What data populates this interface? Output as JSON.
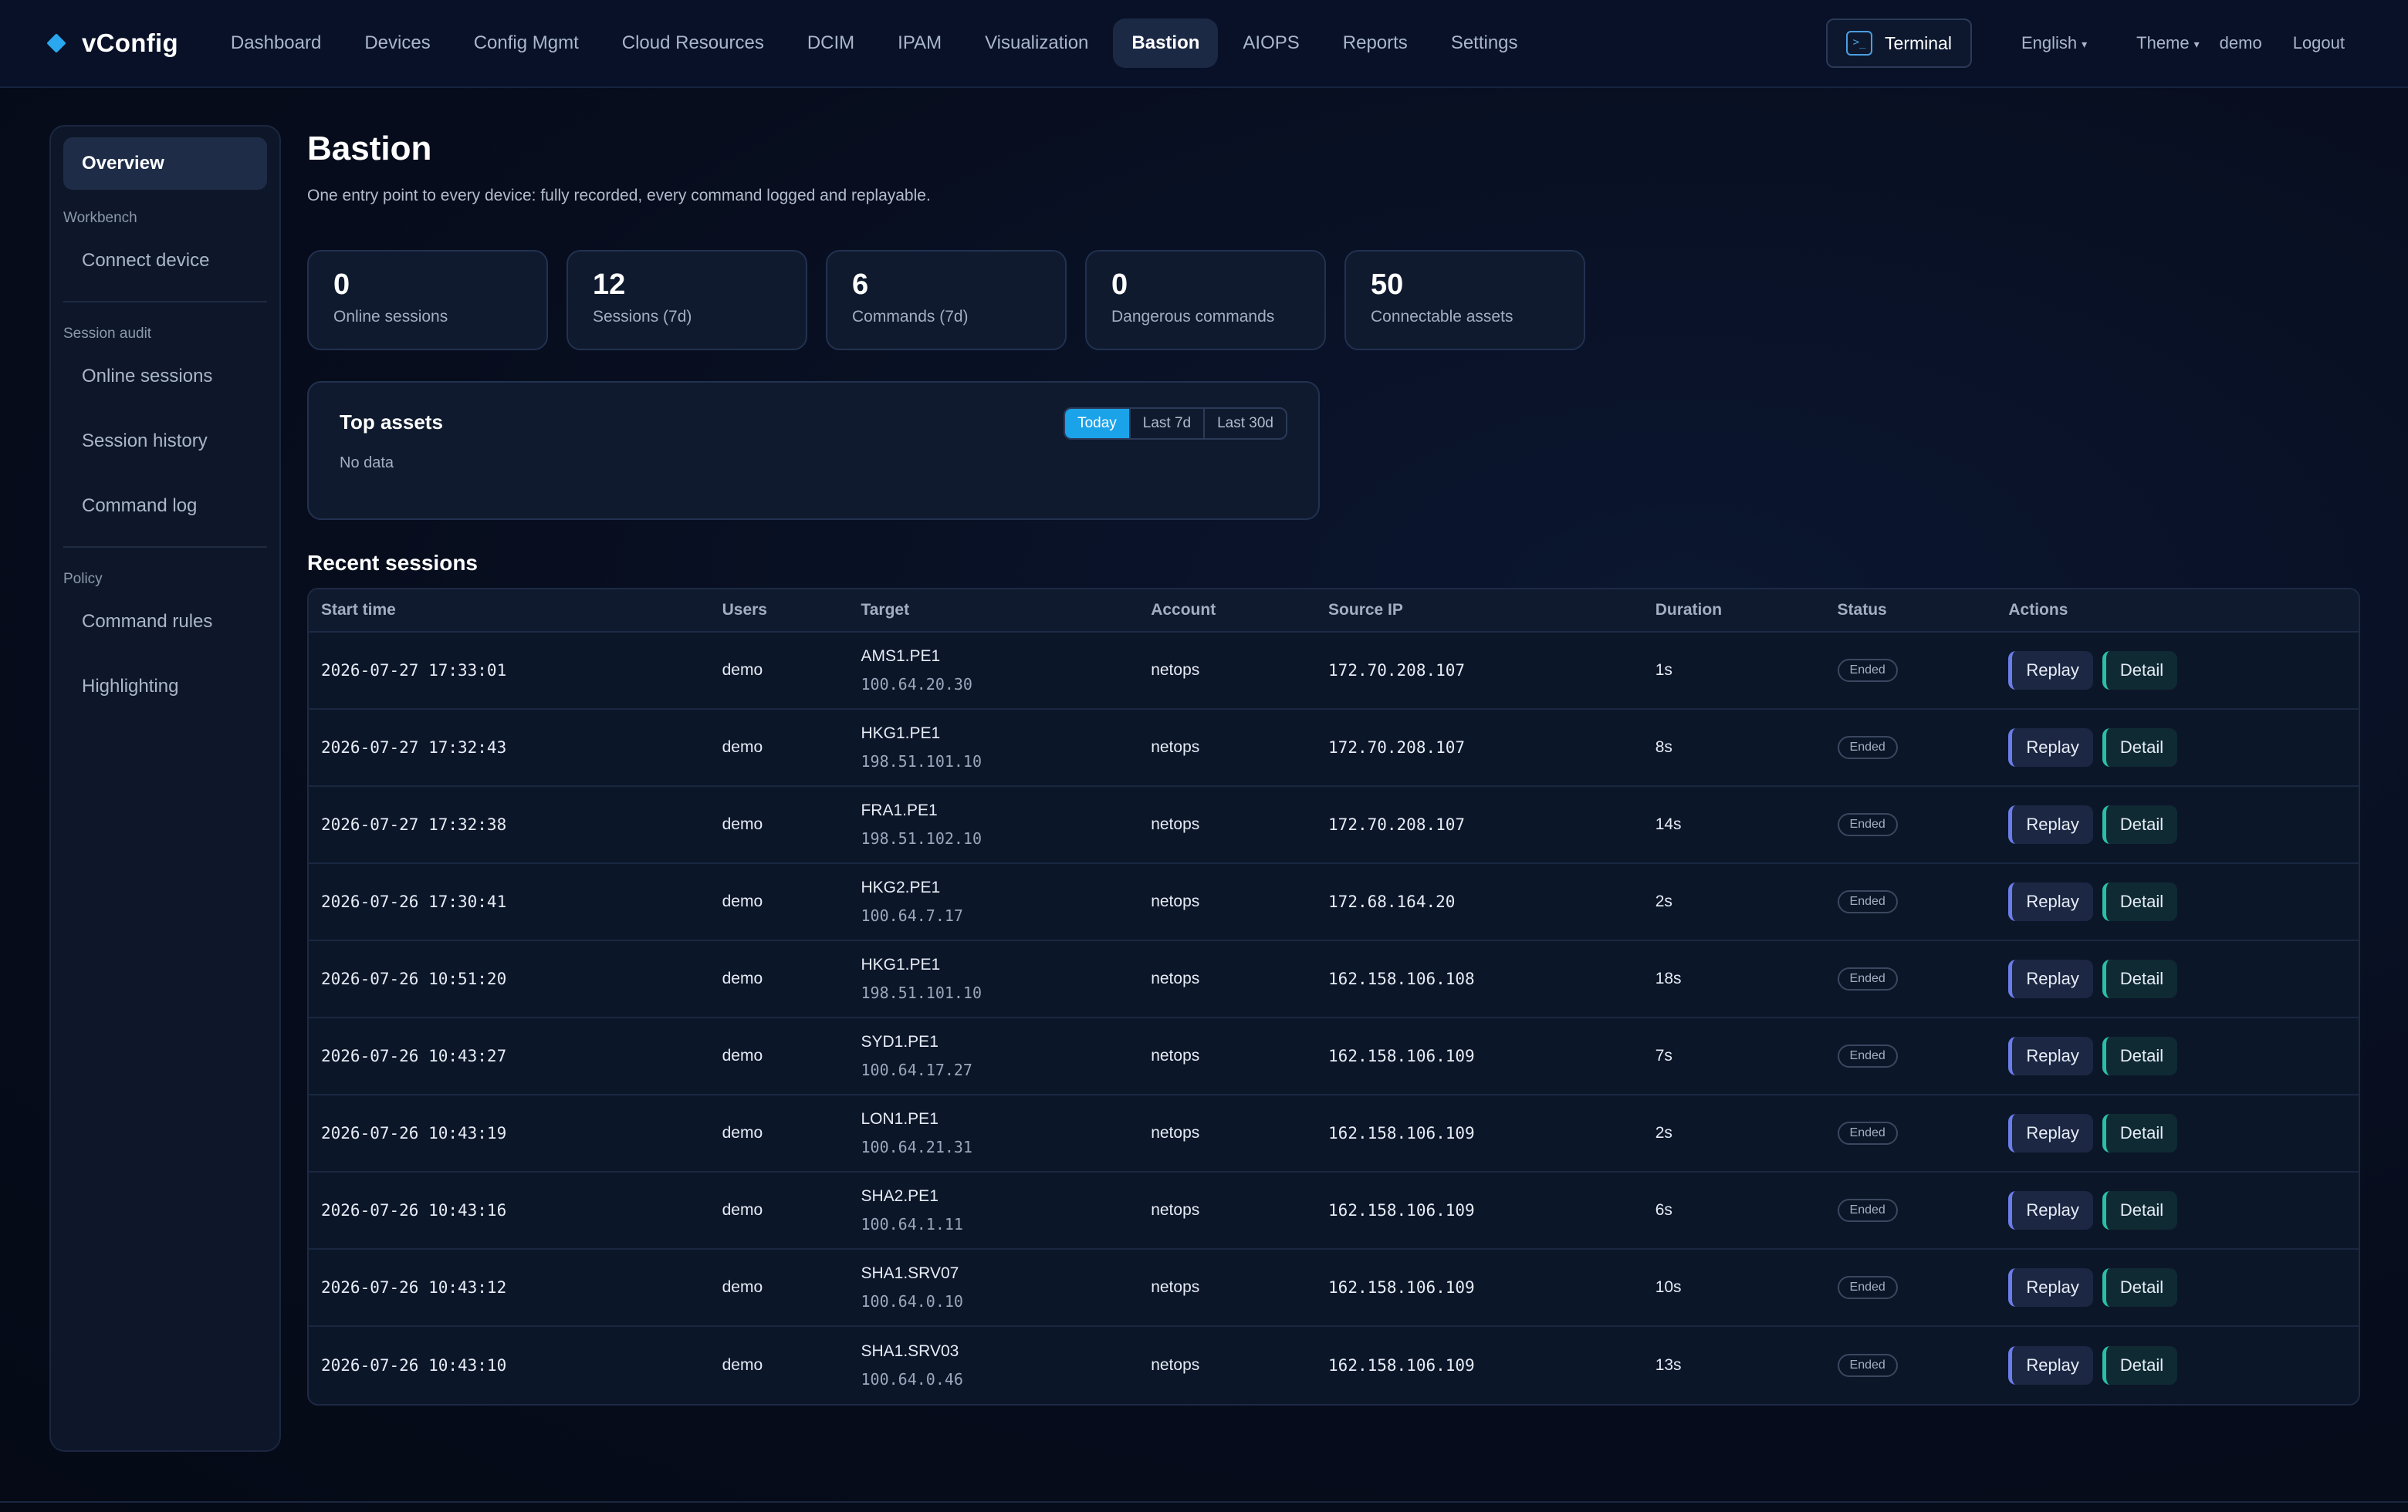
{
  "header": {
    "brand": "vConfig",
    "nav": [
      "Dashboard",
      "Devices",
      "Config Mgmt",
      "Cloud Resources",
      "DCIM",
      "IPAM",
      "Visualization",
      "Bastion",
      "AIOPS",
      "Reports",
      "Settings"
    ],
    "active_nav": "Bastion",
    "terminal_label": "Terminal",
    "terminal_icon": ">_",
    "language": "English",
    "theme": "Theme",
    "user": "demo",
    "logout": "Logout"
  },
  "sidebar": {
    "overview": "Overview",
    "section_workbench": "Workbench",
    "connect_device": "Connect device",
    "section_audit": "Session audit",
    "online_sessions": "Online sessions",
    "session_history": "Session history",
    "command_log": "Command log",
    "section_policy": "Policy",
    "command_rules": "Command rules",
    "highlighting": "Highlighting"
  },
  "main": {
    "title": "Bastion",
    "subtitle": "One entry point to every device: fully recorded, every command logged and replayable.",
    "stats": [
      {
        "value": "0",
        "label": "Online sessions"
      },
      {
        "value": "12",
        "label": "Sessions (7d)"
      },
      {
        "value": "6",
        "label": "Commands (7d)"
      },
      {
        "value": "0",
        "label": "Dangerous commands"
      },
      {
        "value": "50",
        "label": "Connectable assets"
      }
    ],
    "top_assets": {
      "title": "Top assets",
      "empty": "No data",
      "ranges": [
        "Today",
        "Last 7d",
        "Last 30d"
      ],
      "selected_range": "Today"
    },
    "recent_title": "Recent sessions",
    "columns": [
      "Start time",
      "Users",
      "Target",
      "Account",
      "Source IP",
      "Duration",
      "Status",
      "Actions"
    ],
    "rows": [
      {
        "start": "2026-07-27 17:33:01",
        "user": "demo",
        "target": "AMS1.PE1",
        "target_ip": "100.64.20.30",
        "account": "netops",
        "source_ip": "172.70.208.107",
        "duration": "1s",
        "status": "Ended"
      },
      {
        "start": "2026-07-27 17:32:43",
        "user": "demo",
        "target": "HKG1.PE1",
        "target_ip": "198.51.101.10",
        "account": "netops",
        "source_ip": "172.70.208.107",
        "duration": "8s",
        "status": "Ended"
      },
      {
        "start": "2026-07-27 17:32:38",
        "user": "demo",
        "target": "FRA1.PE1",
        "target_ip": "198.51.102.10",
        "account": "netops",
        "source_ip": "172.70.208.107",
        "duration": "14s",
        "status": "Ended"
      },
      {
        "start": "2026-07-26 17:30:41",
        "user": "demo",
        "target": "HKG2.PE1",
        "target_ip": "100.64.7.17",
        "account": "netops",
        "source_ip": "172.68.164.20",
        "duration": "2s",
        "status": "Ended"
      },
      {
        "start": "2026-07-26 10:51:20",
        "user": "demo",
        "target": "HKG1.PE1",
        "target_ip": "198.51.101.10",
        "account": "netops",
        "source_ip": "162.158.106.108",
        "duration": "18s",
        "status": "Ended"
      },
      {
        "start": "2026-07-26 10:43:27",
        "user": "demo",
        "target": "SYD1.PE1",
        "target_ip": "100.64.17.27",
        "account": "netops",
        "source_ip": "162.158.106.109",
        "duration": "7s",
        "status": "Ended"
      },
      {
        "start": "2026-07-26 10:43:19",
        "user": "demo",
        "target": "LON1.PE1",
        "target_ip": "100.64.21.31",
        "account": "netops",
        "source_ip": "162.158.106.109",
        "duration": "2s",
        "status": "Ended"
      },
      {
        "start": "2026-07-26 10:43:16",
        "user": "demo",
        "target": "SHA2.PE1",
        "target_ip": "100.64.1.11",
        "account": "netops",
        "source_ip": "162.158.106.109",
        "duration": "6s",
        "status": "Ended"
      },
      {
        "start": "2026-07-26 10:43:12",
        "user": "demo",
        "target": "SHA1.SRV07",
        "target_ip": "100.64.0.10",
        "account": "netops",
        "source_ip": "162.158.106.109",
        "duration": "10s",
        "status": "Ended"
      },
      {
        "start": "2026-07-26 10:43:10",
        "user": "demo",
        "target": "SHA1.SRV03",
        "target_ip": "100.64.0.46",
        "account": "netops",
        "source_ip": "162.158.106.109",
        "duration": "13s",
        "status": "Ended"
      }
    ],
    "replay_label": "Replay",
    "detail_label": "Detail"
  },
  "colors": {
    "accent": "#1ba3ea",
    "brand_mark": "#2aa7ee",
    "replay_accent": "#6b7de8",
    "detail_accent": "#2bbfa6"
  },
  "icons": {
    "brand": "diamond-icon",
    "terminal": "terminal-icon",
    "dropdown": "chevron-down-icon"
  }
}
